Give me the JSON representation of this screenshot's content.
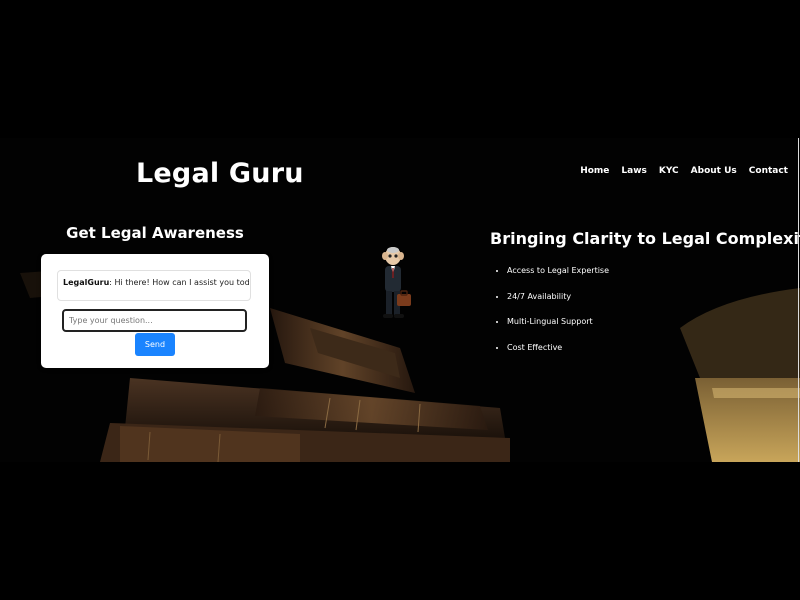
{
  "brand": {
    "title": "Legal Guru"
  },
  "nav": {
    "items": [
      "Home",
      "Laws",
      "KYC",
      "About Us",
      "Contact"
    ]
  },
  "left": {
    "heading": "Get Legal Awareness"
  },
  "chat": {
    "bot_name": "LegalGuru",
    "greeting": ": Hi there! How can I assist you today?",
    "input_placeholder": "Type your question...",
    "input_value": "",
    "send_label": "Send"
  },
  "right": {
    "heading": "Bringing Clarity to Legal Complexity",
    "features": [
      "Access to Legal Expertise",
      "24/7 Availability",
      "Multi-Lingual Support",
      "Cost Effective"
    ]
  },
  "colors": {
    "accent": "#1a84ff",
    "background": "#000000",
    "text": "#ffffff"
  }
}
